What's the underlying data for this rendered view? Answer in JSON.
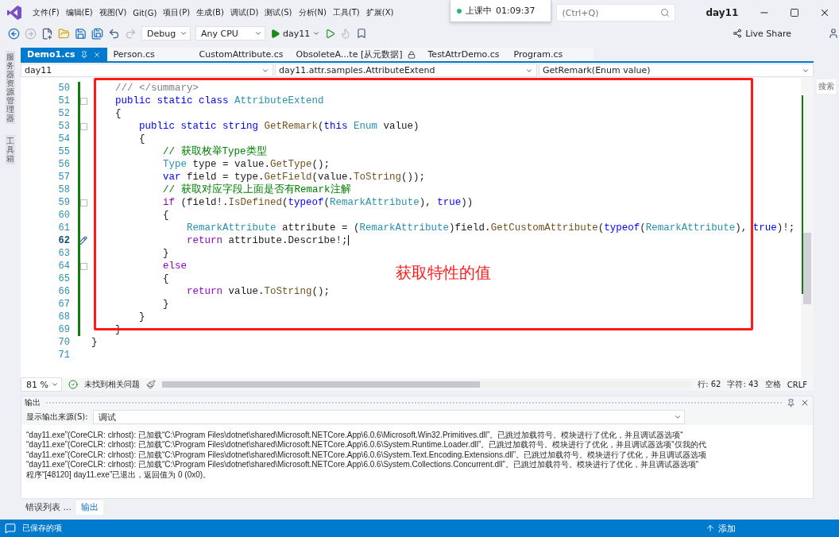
{
  "window": {
    "title": "day11"
  },
  "menu": [
    "文件(F)",
    "编辑(E)",
    "视图(V)",
    "Git(G)",
    "项目(P)",
    "生成(B)",
    "调试(D)",
    "测试(S)",
    "分析(N)",
    "工具(T)",
    "扩展(X)"
  ],
  "session_badge": {
    "label": "上课中",
    "time": "01:09:37"
  },
  "search": {
    "placeholder": "(Ctrl+Q)"
  },
  "toolbar": {
    "configuration": "Debug",
    "platform": "Any CPU",
    "start_target": "day11",
    "live_share": "Live Share"
  },
  "side_panels": [
    "服务器资源管理器",
    "工具箱"
  ],
  "right_panel": {
    "label": "搜索"
  },
  "tabs": [
    {
      "label": "Demo1.cs",
      "selected": true,
      "locked": false
    },
    {
      "label": "Person.cs",
      "selected": false,
      "locked": false
    },
    {
      "label": "CustomAttribute.cs",
      "selected": false,
      "locked": false
    },
    {
      "label": "ObsoleteA...te [从元数据]",
      "selected": false,
      "locked": true
    },
    {
      "label": "TestAttrDemo.cs",
      "selected": false,
      "locked": false
    },
    {
      "label": "Program.cs",
      "selected": false,
      "locked": false
    }
  ],
  "navigation": {
    "project": "day11",
    "type": "day11.attr.samples.AttributeExtend",
    "member": "GetRemark(Enum value)"
  },
  "editor": {
    "annotation": "获取特性的值",
    "lines": [
      {
        "number": "50",
        "foldable": false,
        "current": false,
        "tokens": [
          {
            "kind": "doc",
            "text": "    /// </summary>"
          }
        ]
      },
      {
        "number": "51",
        "foldable": true,
        "current": false,
        "tokens": [
          {
            "kind": "keyword",
            "text": "    public static class"
          },
          {
            "kind": "type",
            "text": " AttributeExtend"
          }
        ]
      },
      {
        "number": "52",
        "foldable": false,
        "current": false,
        "tokens": [
          {
            "kind": "plain",
            "text": "    {"
          }
        ]
      },
      {
        "number": "53",
        "foldable": true,
        "current": false,
        "tokens": [
          {
            "kind": "keyword",
            "text": "        public static string"
          },
          {
            "kind": "method",
            "text": " GetRemark"
          },
          {
            "kind": "plain",
            "text": "("
          },
          {
            "kind": "keyword",
            "text": "this"
          },
          {
            "kind": "type",
            "text": " Enum"
          },
          {
            "kind": "plain",
            "text": " value)"
          }
        ]
      },
      {
        "number": "54",
        "foldable": false,
        "current": false,
        "tokens": [
          {
            "kind": "plain",
            "text": "        {"
          }
        ]
      },
      {
        "number": "55",
        "foldable": false,
        "current": false,
        "tokens": [
          {
            "kind": "comment",
            "text": "            // 获取枚举Type类型"
          }
        ]
      },
      {
        "number": "56",
        "foldable": false,
        "current": false,
        "tokens": [
          {
            "kind": "type",
            "text": "            Type"
          },
          {
            "kind": "plain",
            "text": " type = value."
          },
          {
            "kind": "method",
            "text": "GetType"
          },
          {
            "kind": "plain",
            "text": "();"
          }
        ]
      },
      {
        "number": "57",
        "foldable": false,
        "current": false,
        "tokens": [
          {
            "kind": "keyword",
            "text": "            var"
          },
          {
            "kind": "plain",
            "text": " field = type."
          },
          {
            "kind": "method",
            "text": "GetField"
          },
          {
            "kind": "plain",
            "text": "(value."
          },
          {
            "kind": "method",
            "text": "ToString"
          },
          {
            "kind": "plain",
            "text": "());"
          }
        ]
      },
      {
        "number": "58",
        "foldable": false,
        "current": false,
        "tokens": [
          {
            "kind": "comment",
            "text": "            // 获取对应字段上面是否有Remark注解"
          }
        ]
      },
      {
        "number": "59",
        "foldable": true,
        "current": false,
        "tokens": [
          {
            "kind": "control",
            "text": "            if"
          },
          {
            "kind": "plain",
            "text": " (field!."
          },
          {
            "kind": "method",
            "text": "IsDefined"
          },
          {
            "kind": "plain",
            "text": "("
          },
          {
            "kind": "keyword",
            "text": "typeof"
          },
          {
            "kind": "plain",
            "text": "("
          },
          {
            "kind": "type",
            "text": "RemarkAttribute"
          },
          {
            "kind": "plain",
            "text": "), "
          },
          {
            "kind": "keyword",
            "text": "true"
          },
          {
            "kind": "plain",
            "text": "))"
          }
        ]
      },
      {
        "number": "60",
        "foldable": false,
        "current": false,
        "tokens": [
          {
            "kind": "plain",
            "text": "            {"
          }
        ]
      },
      {
        "number": "61",
        "foldable": false,
        "current": false,
        "tokens": [
          {
            "kind": "type",
            "text": "                RemarkAttribute"
          },
          {
            "kind": "plain",
            "text": " attribute = ("
          },
          {
            "kind": "type",
            "text": "RemarkAttribute"
          },
          {
            "kind": "plain",
            "text": ")field."
          },
          {
            "kind": "method",
            "text": "GetCustomAttribute"
          },
          {
            "kind": "plain",
            "text": "("
          },
          {
            "kind": "keyword",
            "text": "typeof"
          },
          {
            "kind": "plain",
            "text": "("
          },
          {
            "kind": "type",
            "text": "RemarkAttribute"
          },
          {
            "kind": "plain",
            "text": "), "
          },
          {
            "kind": "keyword",
            "text": "true"
          },
          {
            "kind": "plain",
            "text": ")!;"
          }
        ]
      },
      {
        "number": "62",
        "foldable": false,
        "current": true,
        "tokens": [
          {
            "kind": "control",
            "text": "                return"
          },
          {
            "kind": "plain",
            "text": " attribute.Describe!;"
          }
        ]
      },
      {
        "number": "63",
        "foldable": false,
        "current": false,
        "tokens": [
          {
            "kind": "plain",
            "text": "            }"
          }
        ]
      },
      {
        "number": "64",
        "foldable": true,
        "current": false,
        "tokens": [
          {
            "kind": "control",
            "text": "            else"
          }
        ]
      },
      {
        "number": "65",
        "foldable": false,
        "current": false,
        "tokens": [
          {
            "kind": "plain",
            "text": "            {"
          }
        ]
      },
      {
        "number": "66",
        "foldable": false,
        "current": false,
        "tokens": [
          {
            "kind": "control",
            "text": "                return"
          },
          {
            "kind": "plain",
            "text": " value."
          },
          {
            "kind": "method",
            "text": "ToString"
          },
          {
            "kind": "plain",
            "text": "();"
          }
        ]
      },
      {
        "number": "67",
        "foldable": false,
        "current": false,
        "tokens": [
          {
            "kind": "plain",
            "text": "            }"
          }
        ]
      },
      {
        "number": "68",
        "foldable": false,
        "current": false,
        "tokens": [
          {
            "kind": "plain",
            "text": "        }"
          }
        ]
      },
      {
        "number": "69",
        "foldable": false,
        "current": false,
        "tokens": [
          {
            "kind": "plain",
            "text": "    }"
          }
        ]
      },
      {
        "number": "70",
        "foldable": false,
        "current": false,
        "tokens": [
          {
            "kind": "plain",
            "text": "}"
          }
        ]
      },
      {
        "number": "71",
        "foldable": false,
        "current": false
      }
    ]
  },
  "editor_status": {
    "zoom": "81 %",
    "issues": "未找到相关问题",
    "line": "行: 62",
    "column": "字符: 43",
    "whitespace": "空格",
    "line_ending": "CRLF"
  },
  "output": {
    "title": "输出",
    "source_label": "显示输出来源(S):",
    "source": "调试",
    "lines": [
      "“day11.exe”(CoreCLR: clrhost): 已加载“C:\\Program Files\\dotnet\\shared\\Microsoft.NETCore.App\\6.0.6\\Microsoft.Win32.Primitives.dll”。已跳过加载符号。模块进行了优化，并且调试器选项“",
      "“day11.exe”(CoreCLR: clrhost): 已加载“C:\\Program Files\\dotnet\\shared\\Microsoft.NETCore.App\\6.0.6\\System.Runtime.Loader.dll”。已跳过加载符号。模块进行了优化，并且调试器选项“仅我的代",
      "“day11.exe”(CoreCLR: clrhost): 已加载“C:\\Program Files\\dotnet\\shared\\Microsoft.NETCore.App\\6.0.6\\System.Text.Encoding.Extensions.dll”。已跳过加载符号。模块进行了优化，并且调试器选项",
      "“day11.exe”(CoreCLR: clrhost): 已加载“C:\\Program Files\\dotnet\\shared\\Microsoft.NETCore.App\\6.0.6\\System.Collections.Concurrent.dll”。已跳过加载符号。模块进行了优化，并且调试器选项“",
      "程序“[48120] day11.exe”已退出，返回值为 0 (0x0)。"
    ]
  },
  "bottom_tabs": [
    {
      "label": "错误列表 ...",
      "selected": false
    },
    {
      "label": "输出",
      "selected": true
    }
  ],
  "status_bar": {
    "message": "已保存的项",
    "action": "添加"
  }
}
